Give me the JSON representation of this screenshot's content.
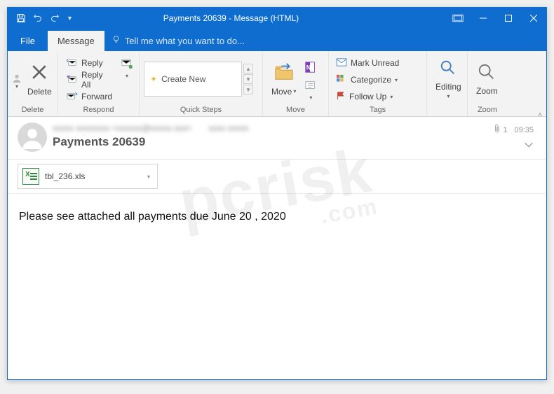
{
  "title": "Payments 20639 - Message (HTML)",
  "tabs": {
    "file": "File",
    "message": "Message",
    "tellme": "Tell me what you want to do..."
  },
  "ribbon": {
    "delete": {
      "label": "Delete",
      "group": "Delete"
    },
    "respond": {
      "reply": "Reply",
      "replyAll": "Reply All",
      "forward": "Forward",
      "group": "Respond"
    },
    "quicksteps": {
      "createNew": "Create New",
      "group": "Quick Steps"
    },
    "move": {
      "label": "Move",
      "group": "Move"
    },
    "tags": {
      "markUnread": "Mark Unread",
      "categorize": "Categorize",
      "followUp": "Follow Up",
      "group": "Tags"
    },
    "editing": {
      "label": "Editing"
    },
    "zoom": {
      "label": "Zoom",
      "group": "Zoom"
    }
  },
  "header": {
    "subject": "Payments 20639",
    "attachmentCount": "1",
    "time": "09:35"
  },
  "attachment": {
    "filename": "tbl_236.xls"
  },
  "body": "Please see attached all payments due June 20 , 2020",
  "watermark": {
    "main": "pcrisk",
    "sub": ".com"
  }
}
